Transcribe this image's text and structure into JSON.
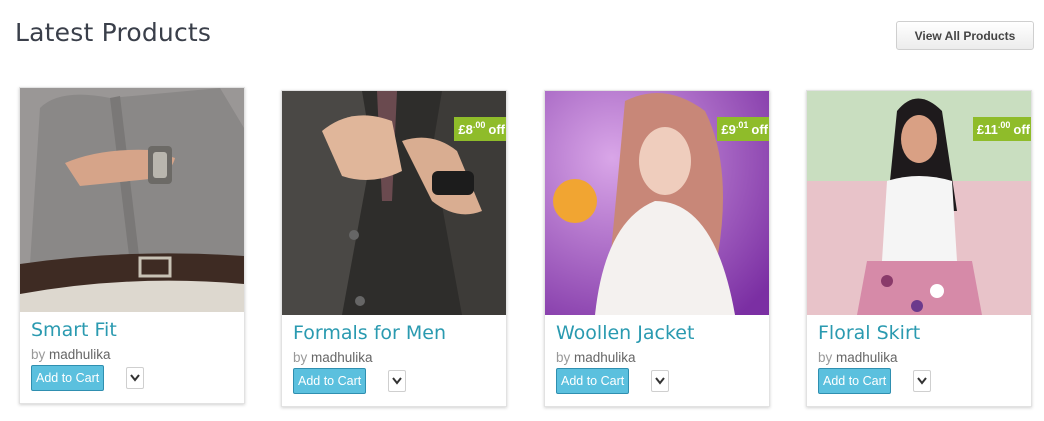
{
  "section": {
    "title": "Latest Products",
    "view_all_label": "View All Products"
  },
  "products": [
    {
      "title": "Smart Fit",
      "by_label": "by",
      "author": "madhulika",
      "add_to_cart_label": "Add to Cart",
      "discount": null,
      "image_desc": "man-shirt-watch"
    },
    {
      "title": "Formals for Men",
      "by_label": "by",
      "author": "madhulika",
      "add_to_cart_label": "Add to Cart",
      "discount": {
        "currency": "£",
        "main": "8",
        "cents": "00",
        "suffix": "off"
      },
      "image_desc": "man-vest-tie"
    },
    {
      "title": "Woollen Jacket",
      "by_label": "by",
      "author": "madhulika",
      "add_to_cart_label": "Add to Cart",
      "discount": {
        "currency": "£",
        "main": "9",
        "cents": "01",
        "suffix": "off"
      },
      "image_desc": "woman-purple"
    },
    {
      "title": "Floral Skirt",
      "by_label": "by",
      "author": "madhulika",
      "add_to_cart_label": "Add to Cart",
      "discount": {
        "currency": "£",
        "main": "11",
        "cents": "00",
        "suffix": "off"
      },
      "image_desc": "woman-floral"
    }
  ],
  "colors": {
    "title_link": "#2a9ab0",
    "discount_badge": "#8fbc2a",
    "add_to_cart": "#5bc0de"
  },
  "icons": {
    "more": "chevron-down-icon"
  }
}
